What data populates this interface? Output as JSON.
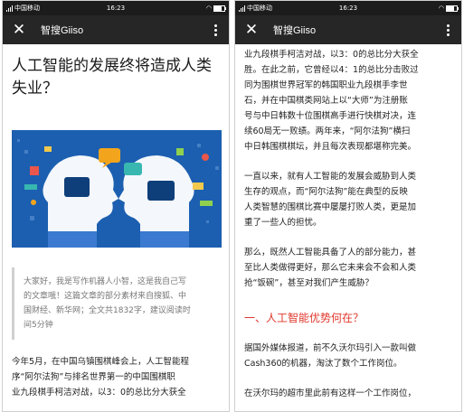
{
  "status_bar": {
    "carrier": "中国移动",
    "time": "16:23"
  },
  "nav": {
    "title": "智搜Giiso",
    "close_icon": "close-icon",
    "more_icon": "more-vertical-icon"
  },
  "article": {
    "title_lines": [
      "人工智能的发展终将造成人类",
      "失业？"
    ],
    "quote_lines": [
      "大家好，我是写作机器人小智，这是我自己写",
      "的文章哦！这篇文章的部分素材来自搜狐、中",
      "国财经、新华网；全文共1832字，建议阅读时",
      "间5分钟"
    ],
    "para1_lines": [
      "今年5月，在中国乌镇围棋峰会上，人工智能程",
      "序“阿尔法狗”与排名世界第一的中国围棋职",
      "业九段棋手柯洁对战，以3：0的总比分大获全"
    ]
  },
  "right_article": {
    "para1_lines": [
      "业九段棋手柯洁对战，以3：0的总比分大获全",
      "胜。在此之前，它曾经以4：1的总比分击败过",
      "同为围棋世界冠军的韩国职业九段棋手李世",
      "石，并在中国棋类网站上以“大师”为注册账",
      "号与中日韩数十位围棋高手进行快棋对决，连",
      "续60局无一败绩。两年来，“阿尔法狗”横扫",
      "中日韩围棋棋坛，并且每次表现都堪称完美。"
    ],
    "para2_lines": [
      "一直以来，就有人工智能的发展会威胁到人类",
      "生存的观点，而“阿尔法狗”能在典型的反映",
      "人类智慧的围棋比赛中屡屡打败人类，更是加",
      "重了一些人的担忧。"
    ],
    "para3_lines": [
      "那么，既然人工智能具备了人的部分能力，甚",
      "至比人类做得更好，那么它未来会不会和人类",
      "抢“饭碗”，甚至对我们产生威胁？"
    ],
    "section_heading": "一、人工智能优势何在？",
    "para4_lines": [
      "据国外媒体报道，前不久沃尔玛引入一款叫做",
      "Cash360的机器，淘汰了数个工作岗位。"
    ],
    "para5_lines": [
      "在沃尔玛的超市里此前有这样一个工作岗位，"
    ]
  },
  "colors": {
    "hero_bg": "#1c5fb0",
    "heading_red": "#e0362b",
    "navbar_bg": "#262626"
  }
}
